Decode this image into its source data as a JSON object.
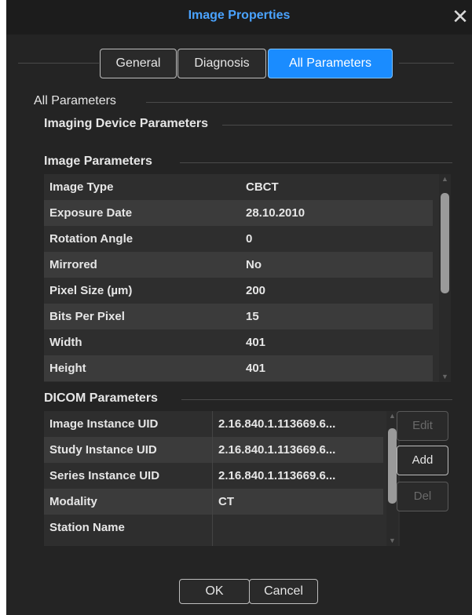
{
  "window": {
    "title": "Image Properties",
    "close_label": "✕"
  },
  "tabs": [
    {
      "label": "General",
      "active": false
    },
    {
      "label": "Diagnosis",
      "active": false
    },
    {
      "label": "All Parameters",
      "active": true
    }
  ],
  "sections": {
    "all_parameters": "All Parameters",
    "imaging_device": "Imaging Device Parameters",
    "image_parameters": "Image Parameters",
    "dicom_parameters": "DICOM Parameters"
  },
  "image_params": [
    {
      "name": "Image Type",
      "value": "CBCT"
    },
    {
      "name": "Exposure Date",
      "value": "28.10.2010"
    },
    {
      "name": "Rotation Angle",
      "value": "0"
    },
    {
      "name": "Mirrored",
      "value": "No"
    },
    {
      "name": "Pixel Size (µm)",
      "value": "200"
    },
    {
      "name": "Bits Per Pixel",
      "value": "15"
    },
    {
      "name": "Width",
      "value": "401"
    },
    {
      "name": "Height",
      "value": "401"
    }
  ],
  "dicom_params": [
    {
      "name": "Image Instance UID",
      "value": "2.16.840.1.113669.6..."
    },
    {
      "name": "Study Instance UID",
      "value": "2.16.840.1.113669.6..."
    },
    {
      "name": "Series Instance UID",
      "value": "2.16.840.1.113669.6..."
    },
    {
      "name": "Modality",
      "value": "CT"
    },
    {
      "name": "Station Name",
      "value": ""
    }
  ],
  "dicom_buttons": {
    "edit": {
      "label": "Edit",
      "enabled": false
    },
    "add": {
      "label": "Add",
      "enabled": true
    },
    "del": {
      "label": "Del",
      "enabled": false
    }
  },
  "footer": {
    "ok": "OK",
    "cancel": "Cancel"
  },
  "colors": {
    "accent": "#1a8cff",
    "title": "#4aa3ff",
    "background": "#242424"
  }
}
